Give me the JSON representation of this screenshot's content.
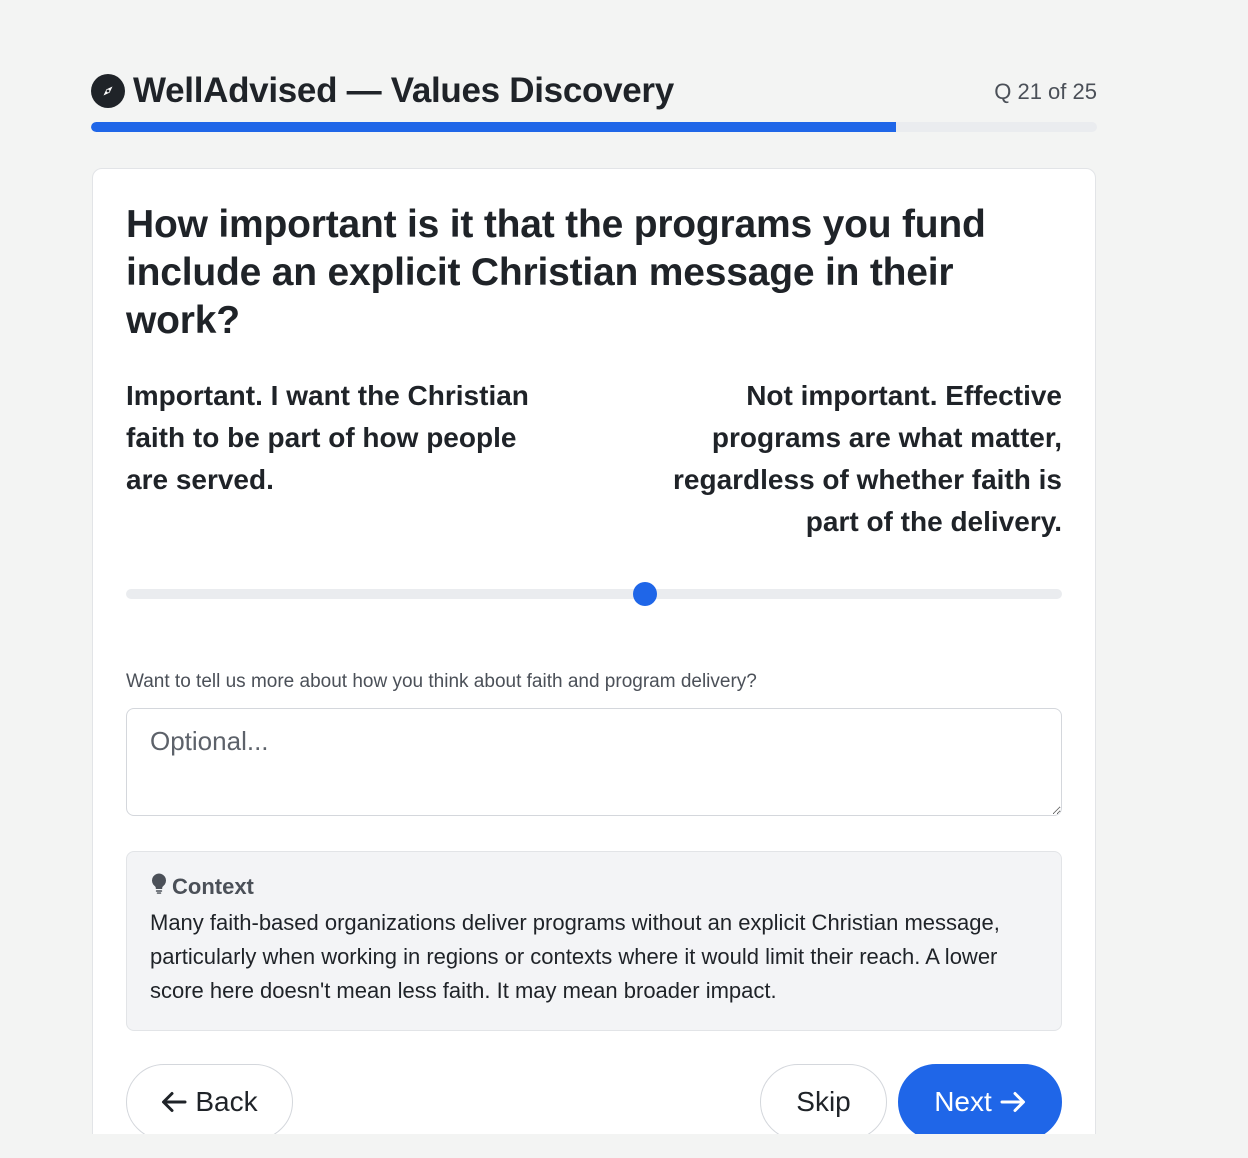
{
  "header": {
    "app_title": "WellAdvised — Values Discovery",
    "question_counter": "Q 21 of 25",
    "logo_icon": "compass-icon"
  },
  "progress": {
    "current": 21,
    "total": 25,
    "fraction": 0.8,
    "color": "#1f66e8"
  },
  "question": {
    "text": "How important is it that the programs you fund include an explicit Christian message in their work?",
    "left_anchor": "Important. I want the Christian faith to be part of how people are served.",
    "right_anchor": "Not important. Effective programs are what matter, regardless of whether faith is part of the delivery.",
    "slider_value": 0.555
  },
  "comment": {
    "label": "Want to tell us more about how you think about faith and program delivery?",
    "placeholder": "Optional...",
    "value": ""
  },
  "context": {
    "icon": "lightbulb-icon",
    "title": "Context",
    "body": "Many faith-based organizations deliver programs without an explicit Christian message, particularly when working in regions or contexts where it would limit their reach. A lower score here doesn't mean less faith. It may mean broader impact."
  },
  "nav": {
    "back_label": "Back",
    "skip_label": "Skip",
    "next_label": "Next"
  }
}
